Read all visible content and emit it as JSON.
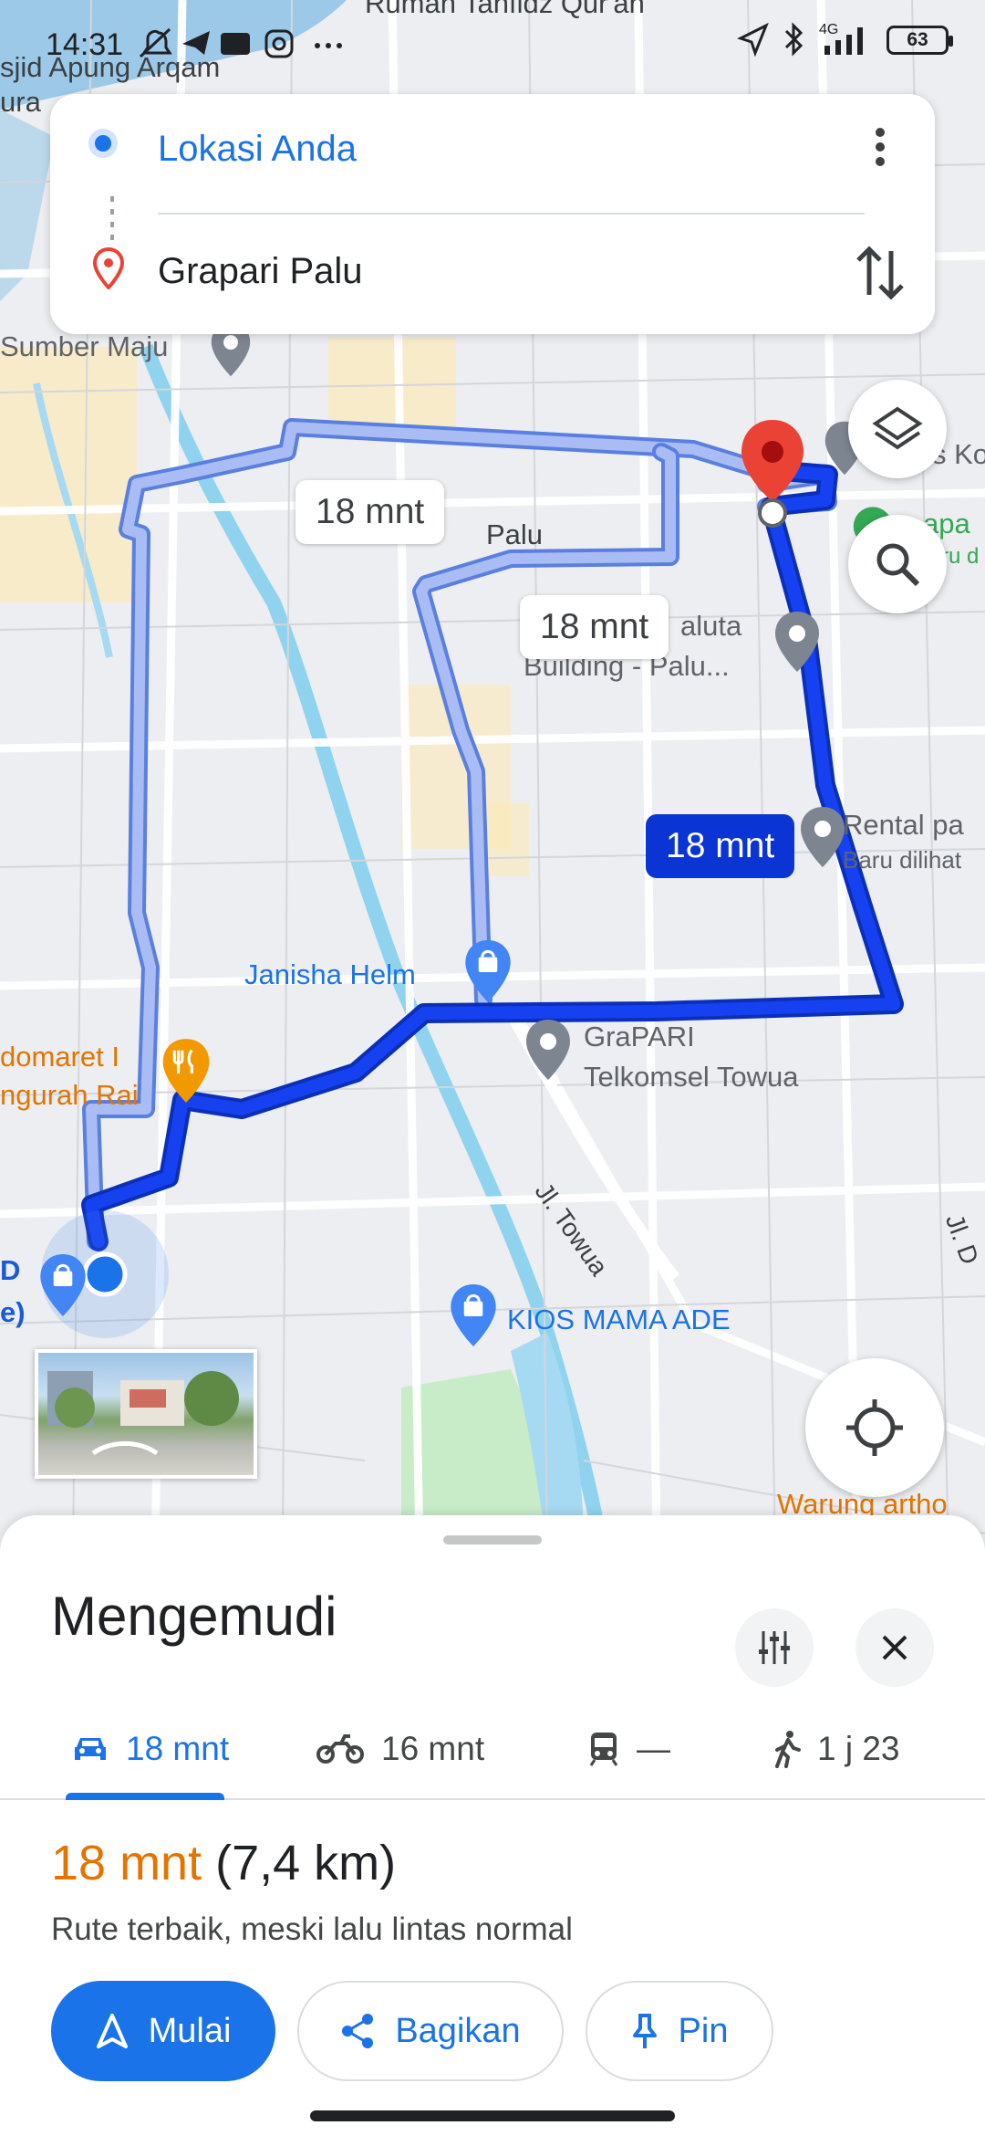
{
  "status_bar": {
    "time": "14:31",
    "network": "4G",
    "battery": "63"
  },
  "directions": {
    "origin": "Lokasi Anda",
    "destination": "Grapari Palu"
  },
  "map": {
    "labels": {
      "masjid": "sjid Apung Arqam",
      "masjid2": "ura",
      "top_road": "Rumah Tahfidz Qur'an",
      "sumber_maju": "Sumber Maju",
      "palu": "Palu",
      "paluta_1": "aluta",
      "paluta_2": "Building - Palu...",
      "rental_1": "Rental pa",
      "rental_2": "Baru dilihat",
      "right_top": "s Ko",
      "green_1": "apa",
      "green_2": "ru d",
      "janisha": "Janisha Helm",
      "grapari_1": "GraPARI",
      "grapari_2": "Telkomsel Towua",
      "indomaret_1": "domaret I",
      "indomaret_2": "ngurah Rai",
      "towua_road": "Jl. Towua",
      "right_road": "Jl. D",
      "left_shop_1": "D",
      "left_shop_2": "e)",
      "kios": "KIOS MAMA ADE",
      "warung": "Warung artho"
    },
    "route_times": {
      "alt1": "18 mnt",
      "alt2": "18 mnt",
      "main": "18 mnt"
    }
  },
  "sheet": {
    "title": "Mengemudi",
    "modes": [
      {
        "name": "car",
        "label": "18 mnt",
        "active": true
      },
      {
        "name": "motorcycle",
        "label": "16 mnt",
        "active": false
      },
      {
        "name": "transit",
        "label": "—",
        "active": false
      },
      {
        "name": "walk",
        "label": "1 j 23",
        "active": false
      }
    ],
    "summary_duration": "18 mnt",
    "summary_distance": "(7,4 km)",
    "route_description": "Rute terbaik, meski lalu lintas normal",
    "buttons": {
      "start": "Mulai",
      "share": "Bagikan",
      "pin": "Pin"
    }
  },
  "colors": {
    "accent": "#1a73e8",
    "route_main": "#0b34d4",
    "route_alt": "#9fb4f0",
    "duration_orange": "#e37400",
    "destination_red": "#ea4335"
  }
}
